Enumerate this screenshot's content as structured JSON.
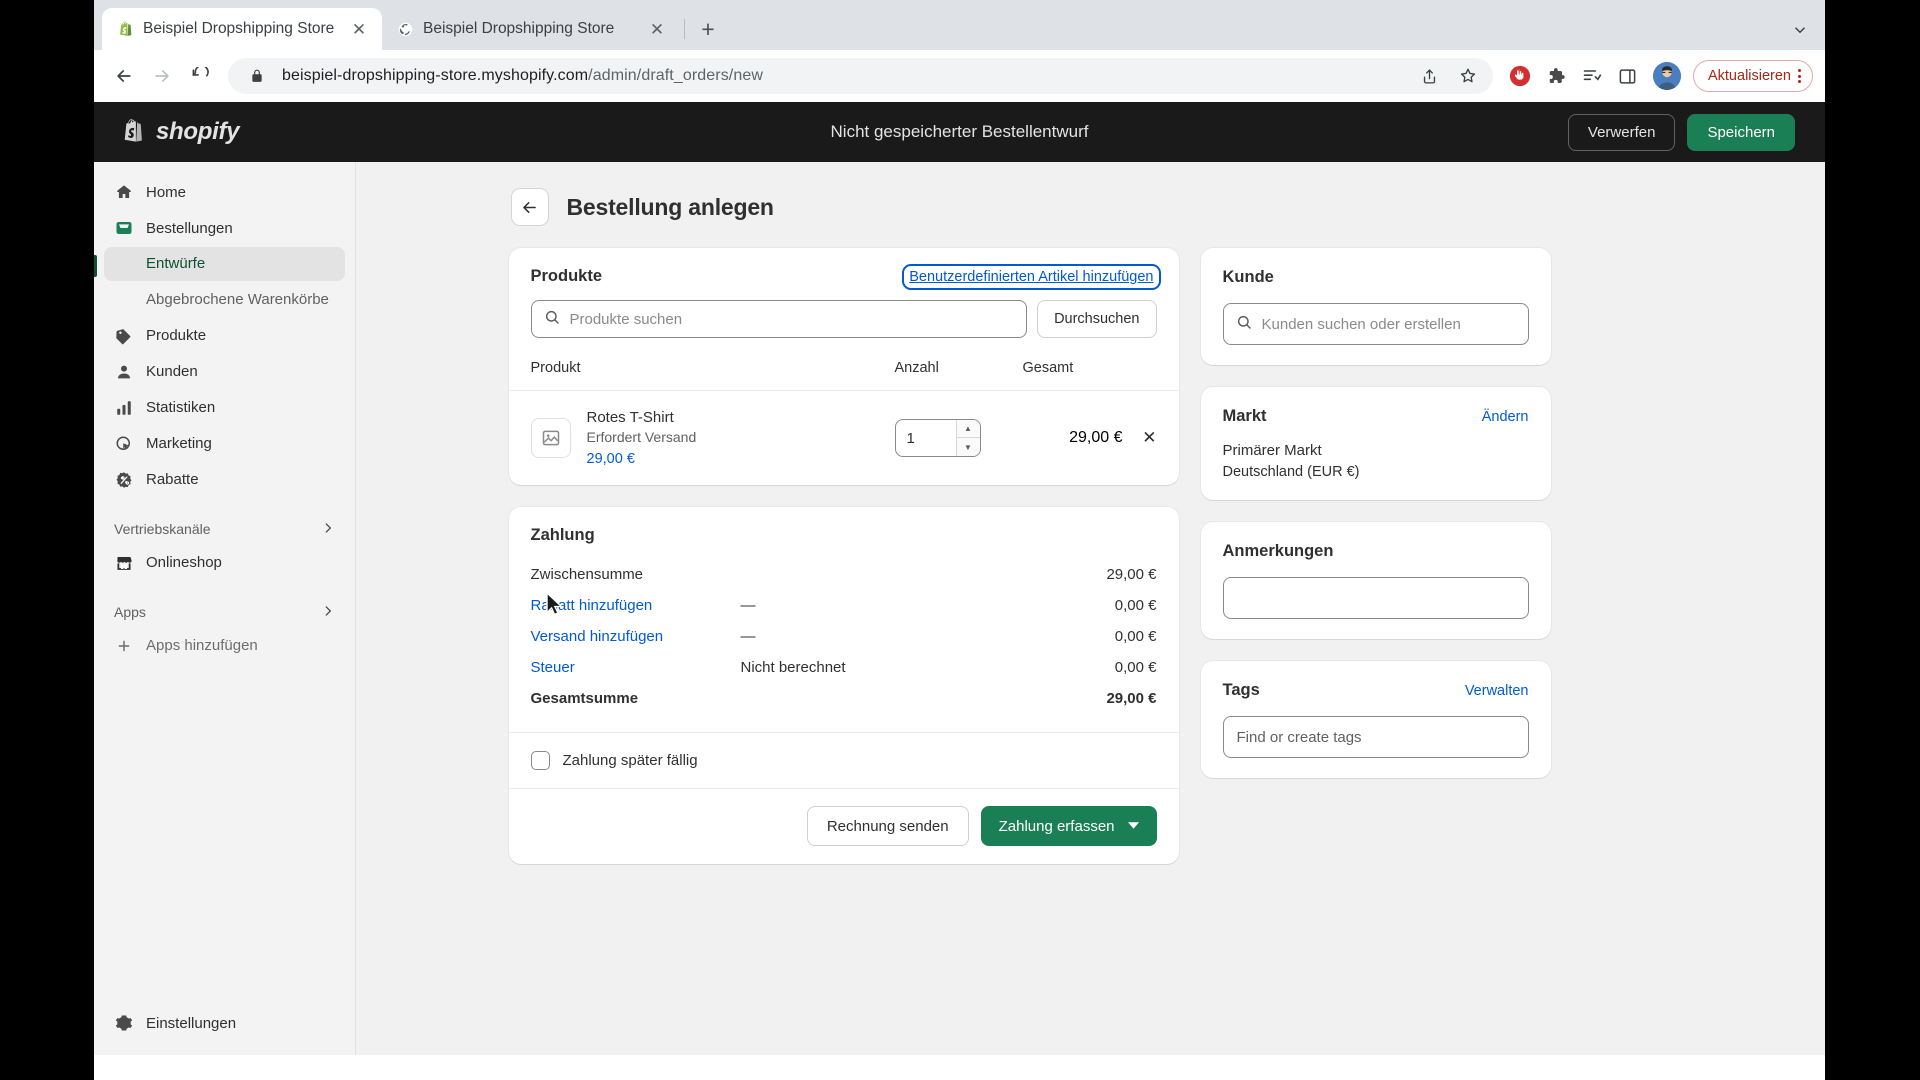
{
  "browser": {
    "tabs": [
      {
        "title": "Beispiel Dropshipping Store · B",
        "favicon": "shopify-icon",
        "active": true
      },
      {
        "title": "Beispiel Dropshipping Store",
        "favicon": "globe-icon",
        "active": false
      }
    ],
    "new_tab_label": "+",
    "close_label": "✕",
    "url_bold": "beispiel-dropshipping-store.myshopify.com",
    "url_dim": "/admin/draft_orders/new",
    "update_label": "Aktualisieren"
  },
  "topbar": {
    "brand": "shopify",
    "title": "Nicht gespeicherter Bestellentwurf",
    "discard_label": "Verwerfen",
    "save_label": "Speichern"
  },
  "sidebar": {
    "items": [
      {
        "label": "Home",
        "icon": "home-icon"
      },
      {
        "label": "Bestellungen",
        "icon": "orders-icon"
      }
    ],
    "sub_items": [
      {
        "label": "Entwürfe",
        "active": true
      },
      {
        "label": "Abgebrochene Warenkörbe",
        "active": false
      }
    ],
    "items2": [
      {
        "label": "Produkte",
        "icon": "tag-icon"
      },
      {
        "label": "Kunden",
        "icon": "person-icon"
      },
      {
        "label": "Statistiken",
        "icon": "bar-chart-icon"
      },
      {
        "label": "Marketing",
        "icon": "marketing-icon"
      },
      {
        "label": "Rabatte",
        "icon": "discount-icon"
      }
    ],
    "section_channels": "Vertriebskanäle",
    "online_store": "Onlineshop",
    "section_apps": "Apps",
    "add_apps": "Apps hinzufügen",
    "settings": "Einstellungen"
  },
  "page": {
    "title": "Bestellung anlegen",
    "back_label": "←"
  },
  "products_card": {
    "title": "Produkte",
    "add_custom_item": "Benutzerdefinierten Artikel hinzufügen",
    "search_placeholder": "Produkte suchen",
    "browse_label": "Durchsuchen",
    "col_product": "Produkt",
    "col_qty": "Anzahl",
    "col_total": "Gesamt",
    "rows": [
      {
        "name": "Rotes T-Shirt",
        "subtitle": "Erfordert Versand",
        "unit_price": "29,00 €",
        "qty": "1",
        "total": "29,00 €",
        "remove_label": "✕"
      }
    ]
  },
  "payment_card": {
    "title": "Zahlung",
    "lines": [
      {
        "label": "Zwischensumme",
        "link": false,
        "mid": "",
        "amount": "29,00 €"
      },
      {
        "label": "Rabatt hinzufügen",
        "link": true,
        "mid": "—",
        "amount": "0,00 €"
      },
      {
        "label": "Versand hinzufügen",
        "link": true,
        "mid": "—",
        "amount": "0,00 €"
      },
      {
        "label": "Steuer",
        "link": true,
        "mid": "Nicht berechnet",
        "amount": "0,00 €"
      }
    ],
    "total_label": "Gesamtsumme",
    "total_amount": "29,00 €",
    "defer_label": "Zahlung später fällig",
    "send_invoice_label": "Rechnung senden",
    "collect_payment_label": "Zahlung erfassen"
  },
  "customer_card": {
    "title": "Kunde",
    "search_placeholder": "Kunden suchen oder erstellen"
  },
  "market_card": {
    "title": "Markt",
    "action_label": "Ändern",
    "primary_label": "Primärer Markt",
    "value": "Deutschland (EUR €)"
  },
  "notes_card": {
    "title": "Anmerkungen",
    "value": ""
  },
  "tags_card": {
    "title": "Tags",
    "action_label": "Verwalten",
    "placeholder": "Find or create tags"
  },
  "colors": {
    "shopify_green": "#1a7f54",
    "link_blue": "#005bd3",
    "topbar_black": "#1a1a1a",
    "active_green": "#0c5132",
    "update_red": "#a52714"
  }
}
